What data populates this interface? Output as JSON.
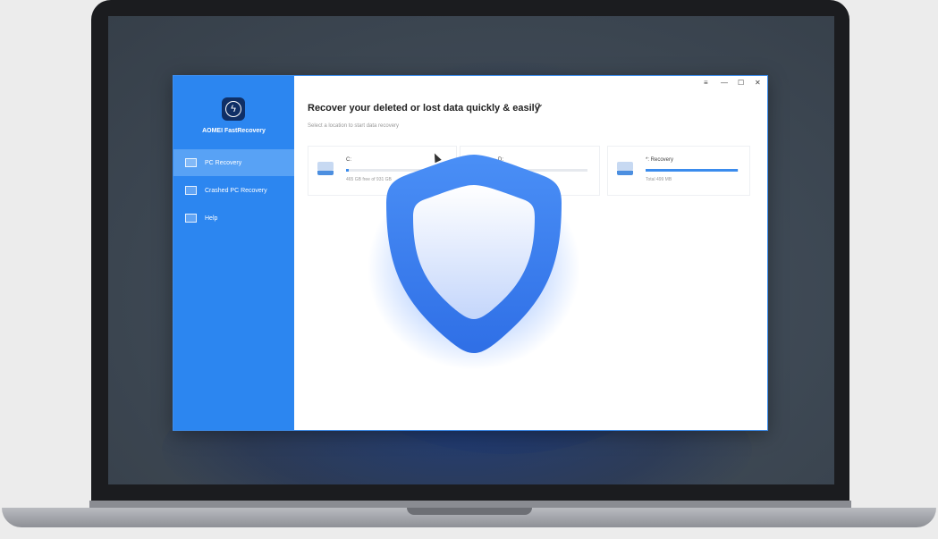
{
  "app": {
    "name": "AOMEI FastRecovery",
    "title": "Recover your deleted or lost data quickly & easily",
    "subtitle": "Select a location to start data recovery"
  },
  "window_controls": [
    "≡",
    "—",
    "☐",
    "✕"
  ],
  "sidebar": {
    "items": [
      {
        "label": "PC Recovery",
        "active": true,
        "icon": "monitor-icon"
      },
      {
        "label": "Crashed PC Recovery",
        "active": false,
        "icon": "crashed-pc-icon"
      },
      {
        "label": "Help",
        "active": false,
        "icon": "help-icon"
      }
    ]
  },
  "drives": [
    {
      "name": "C:",
      "info": "465 GB free of 931 GB",
      "used_fraction": 0.03,
      "icon": "drive-icon"
    },
    {
      "name": "D:",
      "info": "",
      "used_fraction": 0.02,
      "icon": "drive-icon"
    },
    {
      "name": "*: Recovery",
      "info": "Total 499 MB",
      "used_fraction": 0.99,
      "icon": "drive-icon"
    }
  ],
  "overlay_icon": "shield-icon",
  "colors": {
    "accent": "#2c86f0",
    "sidebar_active": "#58a2f5",
    "shield_outer": "#3b82f6",
    "shield_inner": "#e6efff"
  }
}
